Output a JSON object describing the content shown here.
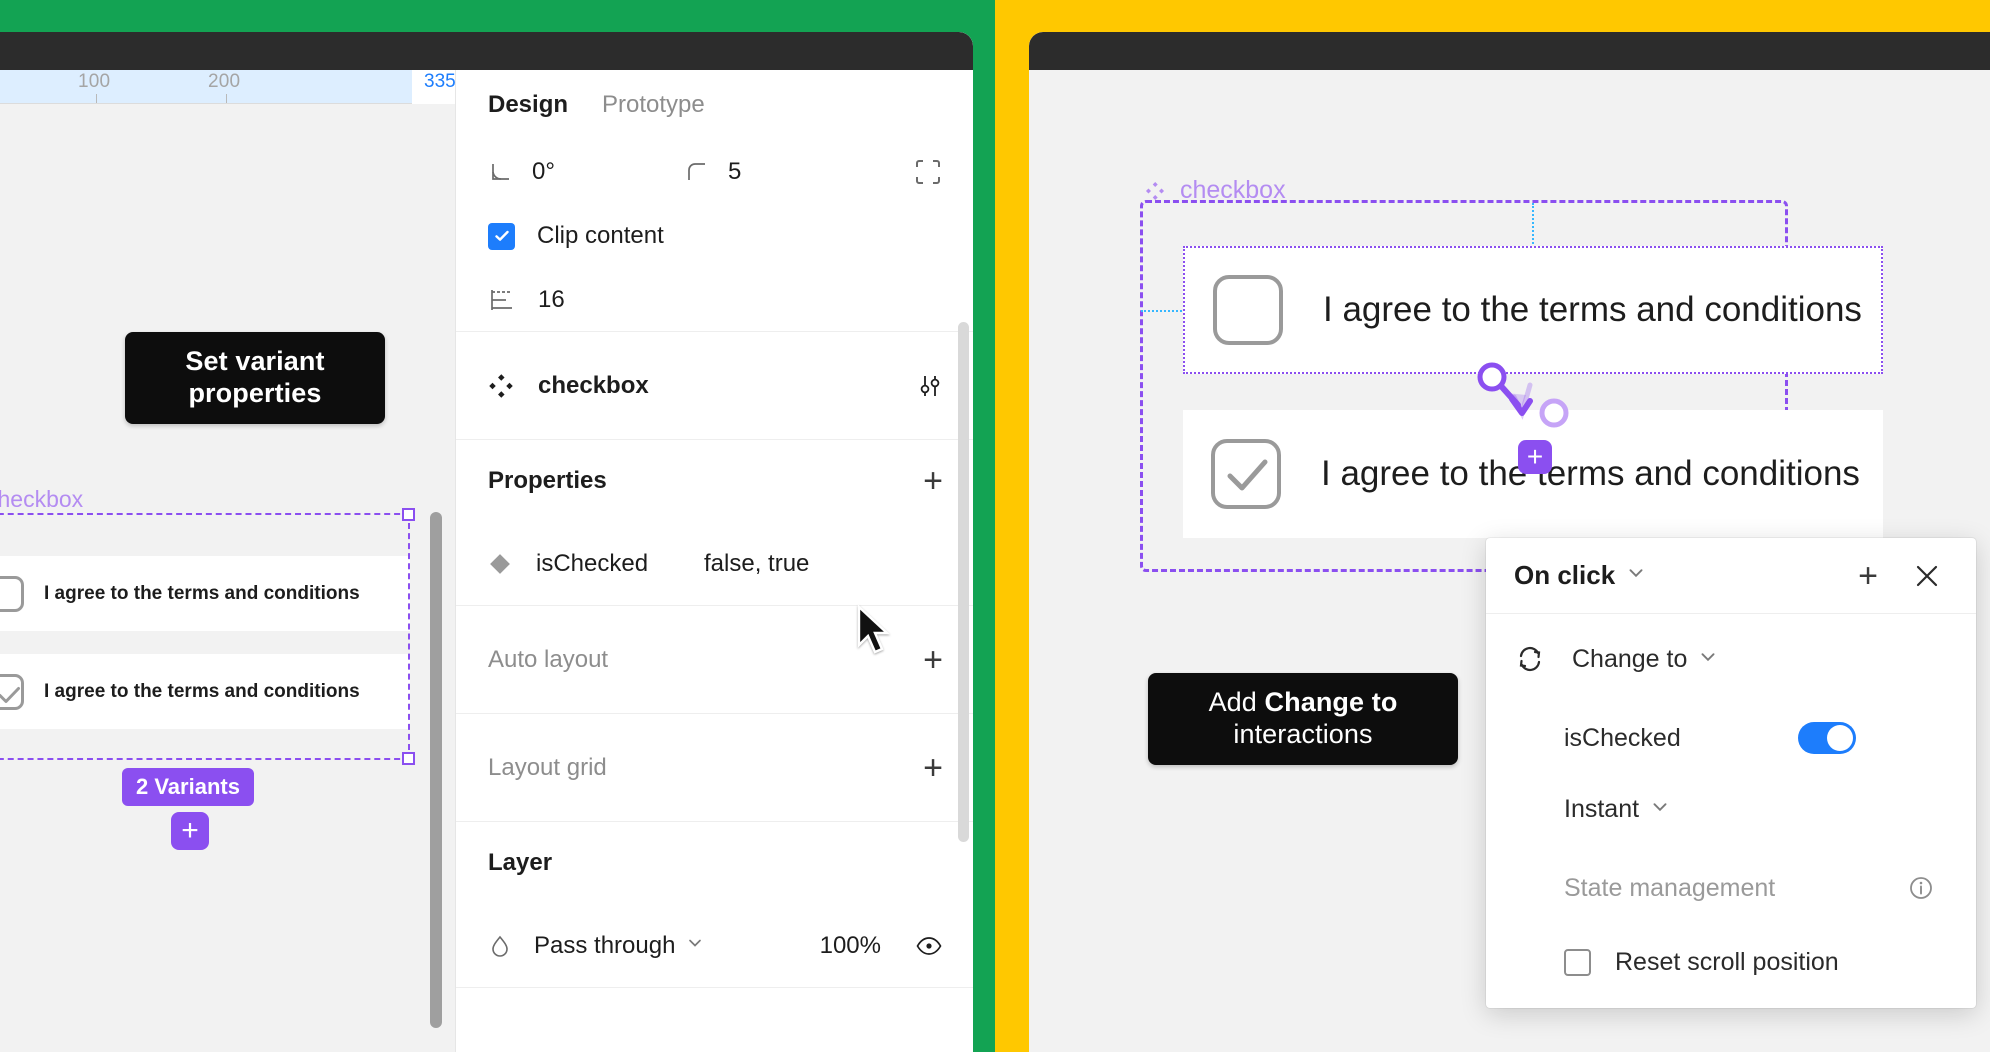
{
  "colors": {
    "green_panel": "#13a353",
    "yellow_panel": "#ffc800",
    "titlebar": "#2c2c2c",
    "accent_purple": "#8b4ff0",
    "accent_blue": "#1d7dfc",
    "guide_blue": "#36b7ff",
    "canvas": "#f2f2f2"
  },
  "left_window": {
    "ruler": {
      "ticks": [
        "100",
        "200"
      ],
      "selection_label": "335"
    },
    "canvas": {
      "tooltip": "Set variant properties",
      "component_set_label": "checkbox",
      "variants_badge": "2 Variants",
      "add_variant_label": "+",
      "rows": [
        {
          "checked": false,
          "label": "I agree to the terms and conditions"
        },
        {
          "checked": true,
          "label": "I agree to the terms and conditions"
        }
      ]
    },
    "design_panel": {
      "tabs": [
        {
          "label": "Design",
          "active": true
        },
        {
          "label": "Prototype",
          "active": false
        }
      ],
      "rotation": {
        "icon": "angle-icon",
        "value": "0°"
      },
      "corner_radius": {
        "icon": "corner-radius-icon",
        "value": "5"
      },
      "independent_corners_label": "independent-corners-icon",
      "clip_content": {
        "label": "Clip content",
        "checked": true
      },
      "spacing": {
        "icon": "spacing-icon",
        "value": "16"
      },
      "component": {
        "icon": "component-set-icon",
        "name": "checkbox",
        "edit_icon": "sliders-icon"
      },
      "properties_section": {
        "title": "Properties",
        "add_label": "+"
      },
      "properties": [
        {
          "icon": "variant-diamond-icon",
          "name": "isChecked",
          "values": "false, true"
        }
      ],
      "auto_layout": {
        "title": "Auto layout",
        "add_label": "+"
      },
      "layout_grid": {
        "title": "Layout grid",
        "add_label": "+"
      },
      "layer_section": {
        "title": "Layer"
      },
      "layer": {
        "blend_mode": "Pass through",
        "opacity": "100%",
        "visibility_icon": "eye-icon"
      }
    }
  },
  "right_window": {
    "canvas": {
      "tooltip_prefix": "Add ",
      "tooltip_bold": "Change to",
      "tooltip_suffix": " interactions",
      "component_set_label": "checkbox",
      "rows": [
        {
          "checked": false,
          "label": "I agree to the terms and conditions"
        },
        {
          "checked": true,
          "label": "I agree to the terms and conditions"
        }
      ],
      "connector_add_label": "+"
    },
    "onclick_panel": {
      "trigger": "On click",
      "trigger_caret": "chevron-down-icon",
      "add_label": "+",
      "close_label": "×",
      "action": {
        "icon": "change-to-icon",
        "label": "Change to",
        "caret": "chevron-down-icon"
      },
      "variant_property": {
        "name": "isChecked",
        "value": true
      },
      "animation": {
        "label": "Instant",
        "caret": "chevron-down-icon"
      },
      "state_management": {
        "label": "State management",
        "info_icon": "info-icon"
      },
      "reset_scroll": {
        "label": "Reset scroll position",
        "checked": false
      }
    }
  }
}
